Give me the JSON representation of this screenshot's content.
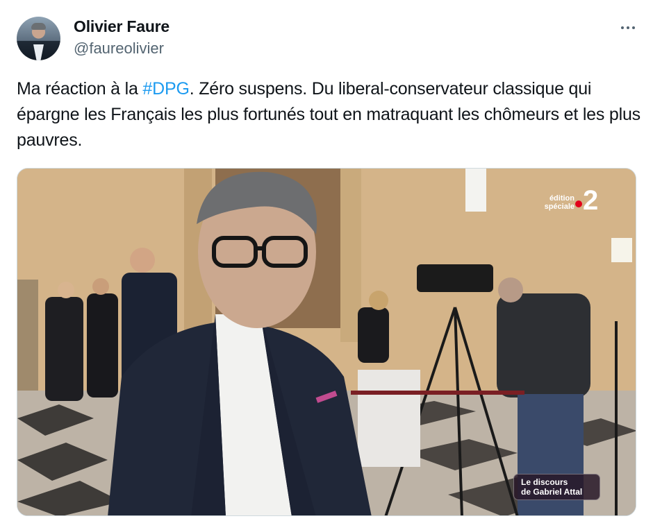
{
  "author": {
    "display_name": "Olivier Faure",
    "handle": "@faureolivier",
    "avatar_icon": "profile-photo"
  },
  "more_icon": "ellipsis-icon",
  "tweet": {
    "text_before": "Ma réaction à la ",
    "hashtag": "#DPG",
    "text_after": ". Zéro suspens. Du liberal-conservateur classique qui épargne les Français les plus fortunés tout en matraquant les chômeurs et les plus pauvres."
  },
  "media": {
    "channel_logo_text": "édition spéciale",
    "channel_number": "2",
    "caption_line1": "Le discours",
    "caption_line2": "de Gabriel Attal",
    "colors": {
      "hashtag": "#1d9bf0",
      "channel_dot": "#e2001a"
    }
  }
}
